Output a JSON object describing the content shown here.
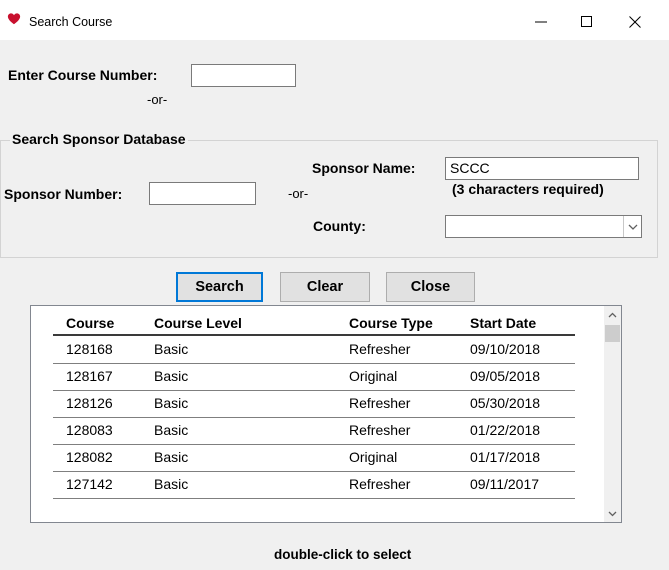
{
  "window": {
    "title": "Search Course",
    "icon": "heart-icon",
    "accent_color": "#0078d7",
    "icon_color": "#c8102e"
  },
  "course_number": {
    "label": "Enter Course Number:",
    "value": "",
    "or_label": "-or-"
  },
  "sponsor_search": {
    "group_title": "Search Sponsor Database",
    "sponsor_name_label": "Sponsor Name:",
    "sponsor_name_value": "SCCC",
    "sponsor_name_hint": "(3 characters required)",
    "sponsor_number_label": "Sponsor Number:",
    "sponsor_number_value": "",
    "or_label": "-or-",
    "county_label": "County:",
    "county_value": ""
  },
  "buttons": {
    "search": "Search",
    "clear": "Clear",
    "close": "Close"
  },
  "results": {
    "columns": [
      "Course",
      "Course Level",
      "Course Type",
      "Start Date"
    ],
    "rows": [
      [
        "128168",
        "Basic",
        "Refresher",
        "09/10/2018"
      ],
      [
        "128167",
        "Basic",
        "Original",
        "09/05/2018"
      ],
      [
        "128126",
        "Basic",
        "Refresher",
        "05/30/2018"
      ],
      [
        "128083",
        "Basic",
        "Refresher",
        "01/22/2018"
      ],
      [
        "128082",
        "Basic",
        "Original",
        "01/17/2018"
      ],
      [
        "127142",
        "Basic",
        "Refresher",
        "09/11/2017"
      ]
    ]
  },
  "footer": {
    "hint": "double-click to select"
  }
}
